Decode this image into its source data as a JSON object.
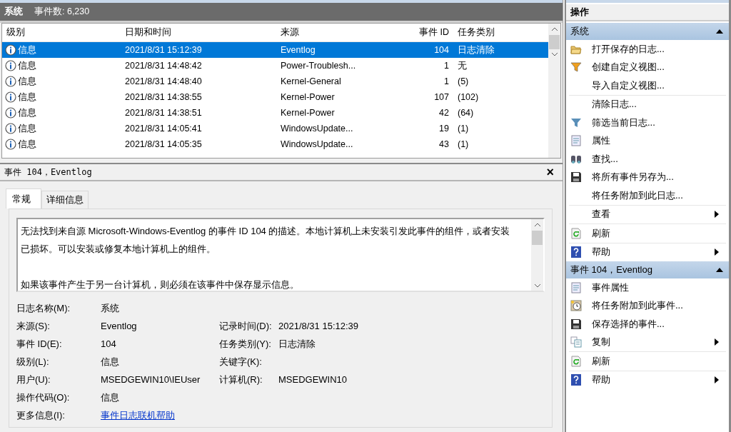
{
  "log_header": {
    "name": "系统",
    "count": "事件数: 6,230"
  },
  "table": {
    "columns": [
      "级别",
      "日期和时间",
      "来源",
      "事件 ID",
      "任务类别"
    ],
    "rows": [
      {
        "level": "信息",
        "datetime": "2021/8/31 15:12:39",
        "source": "Eventlog",
        "event_id": "104",
        "task": "日志清除",
        "selected": true
      },
      {
        "level": "信息",
        "datetime": "2021/8/31 14:48:42",
        "source": "Power-Troublesh...",
        "event_id": "1",
        "task": "无",
        "selected": false
      },
      {
        "level": "信息",
        "datetime": "2021/8/31 14:48:40",
        "source": "Kernel-General",
        "event_id": "1",
        "task": "(5)",
        "selected": false
      },
      {
        "level": "信息",
        "datetime": "2021/8/31 14:38:55",
        "source": "Kernel-Power",
        "event_id": "107",
        "task": "(102)",
        "selected": false
      },
      {
        "level": "信息",
        "datetime": "2021/8/31 14:38:51",
        "source": "Kernel-Power",
        "event_id": "42",
        "task": "(64)",
        "selected": false
      },
      {
        "level": "信息",
        "datetime": "2021/8/31 14:05:41",
        "source": "WindowsUpdate...",
        "event_id": "19",
        "task": "(1)",
        "selected": false
      },
      {
        "level": "信息",
        "datetime": "2021/8/31 14:05:35",
        "source": "WindowsUpdate...",
        "event_id": "43",
        "task": "(1)",
        "selected": false
      }
    ]
  },
  "detail": {
    "title": "事件 104，Eventlog",
    "close": "×",
    "tabs": [
      {
        "label": "常规",
        "selected": true
      },
      {
        "label": "详细信息",
        "selected": false
      }
    ],
    "description": [
      "无法找到来自源 Microsoft-Windows-Eventlog 的事件 ID 104 的描述。本地计算机上未安装引发此事件的组件，或者安装已损坏。可以安装或修复本地计算机上的组件。",
      "如果该事件产生于另一台计算机，则必须在该事件中保存显示信息。"
    ],
    "fields": [
      [
        {
          "label": "日志名称(M):",
          "value": "系统"
        }
      ],
      [
        {
          "label": "来源(S):",
          "value": "Eventlog"
        },
        {
          "label": "记录时间(D):",
          "value": "2021/8/31 15:12:39"
        }
      ],
      [
        {
          "label": "事件 ID(E):",
          "value": "104"
        },
        {
          "label": "任务类别(Y):",
          "value": "日志清除"
        }
      ],
      [
        {
          "label": "级别(L):",
          "value": "信息"
        },
        {
          "label": "关键字(K):"
        }
      ],
      [
        {
          "label": "用户(U):",
          "value": "MSEDGEWIN10\\IEUser"
        },
        {
          "label": "计算机(R):",
          "value": "MSEDGEWIN10"
        }
      ],
      [
        {
          "label": "操作代码(O):",
          "value": "信息"
        }
      ],
      [
        {
          "label": "更多信息(I):",
          "value": "事件日志联机帮助",
          "kind": "link"
        }
      ]
    ]
  },
  "actions": {
    "title": "操作",
    "sections": [
      {
        "title": "系统",
        "expanded": true,
        "groups": [
          [
            {
              "label": "打开保存的日志...",
              "kind": "folder",
              "submenu": false
            },
            {
              "label": "创建自定义视图...",
              "kind": "funnel-color",
              "submenu": false
            },
            {
              "label": "导入自定义视图...",
              "kind": "plain",
              "submenu": false
            }
          ],
          [
            {
              "label": "清除日志...",
              "kind": "plain",
              "submenu": false
            },
            {
              "label": "筛选当前日志...",
              "kind": "funnel",
              "submenu": false
            },
            {
              "label": "属性",
              "kind": "properties",
              "submenu": false
            },
            {
              "label": "查找...",
              "kind": "binoculars",
              "submenu": false
            },
            {
              "label": "将所有事件另存为...",
              "kind": "save",
              "submenu": false
            },
            {
              "label": "将任务附加到此日志...",
              "kind": "plain",
              "submenu": false
            }
          ],
          [
            {
              "label": "查看",
              "kind": "plain",
              "submenu": true
            }
          ],
          [
            {
              "label": "刷新",
              "kind": "refresh",
              "submenu": false
            }
          ],
          [
            {
              "label": "帮助",
              "kind": "help",
              "submenu": true
            }
          ]
        ]
      },
      {
        "title": "事件 104，Eventlog",
        "expanded": true,
        "groups": [
          [
            {
              "label": "事件属性",
              "kind": "properties",
              "submenu": false
            },
            {
              "label": "将任务附加到此事件...",
              "kind": "clock",
              "submenu": false
            },
            {
              "label": "保存选择的事件...",
              "kind": "save",
              "submenu": false
            },
            {
              "label": "复制",
              "kind": "copy",
              "submenu": true
            }
          ],
          [
            {
              "label": "刷新",
              "kind": "refresh",
              "submenu": false
            }
          ],
          [
            {
              "label": "帮助",
              "kind": "help",
              "submenu": true
            }
          ]
        ]
      }
    ]
  }
}
